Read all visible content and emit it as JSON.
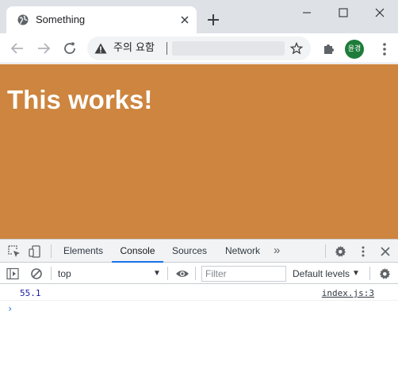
{
  "colors": {
    "page_background": "#cd853f",
    "tab_strip": "#dee1e6",
    "avatar": "#1e7c3a",
    "console_number": "#1a1aa6",
    "devtools_accent": "#1a73e8"
  },
  "browser": {
    "tab": {
      "title": "Something",
      "favicon": "globe-icon"
    },
    "address_bar": {
      "security_label": "주의 요함",
      "security_icon": "warning-icon"
    },
    "profile_initials": "윤경"
  },
  "page": {
    "heading": "This works!"
  },
  "devtools": {
    "tabs": [
      {
        "label": "Elements"
      },
      {
        "label": "Console",
        "active": true
      },
      {
        "label": "Sources"
      },
      {
        "label": "Network"
      }
    ],
    "more_tabs": "»",
    "console": {
      "context": "top",
      "filter_placeholder": "Filter",
      "levels": "Default levels",
      "messages": [
        {
          "value": "55.1",
          "source": "index.js:3"
        }
      ],
      "prompt": "›"
    }
  }
}
